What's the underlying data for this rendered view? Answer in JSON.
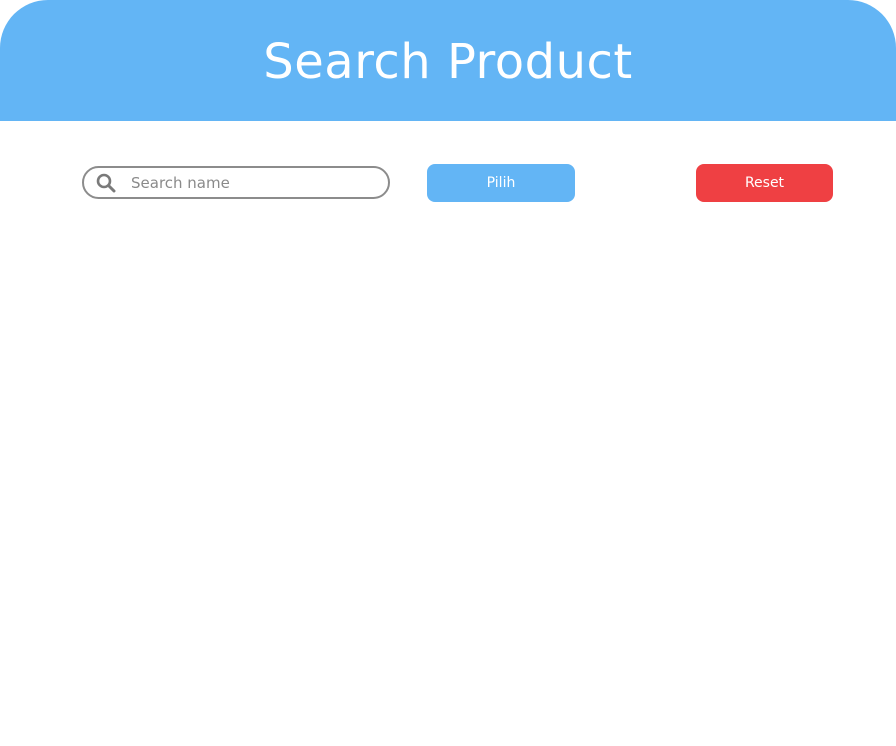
{
  "header": {
    "title": "Search Product"
  },
  "search": {
    "placeholder": "Search name",
    "value": "",
    "icon": "search-icon"
  },
  "buttons": {
    "pilih_label": "Pilih",
    "reset_label": "Reset"
  },
  "colors": {
    "primary": "#63B5F5",
    "danger": "#EF4043",
    "border": "#8C8C8C"
  }
}
